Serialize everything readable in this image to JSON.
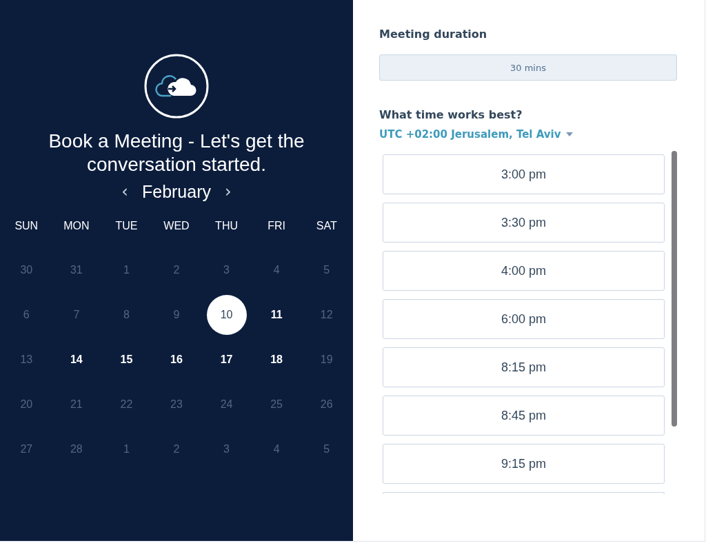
{
  "booking": {
    "title": "Book a Meeting - Let's get the conversation started.",
    "month": "February",
    "prev": "‹",
    "next": "›",
    "weekdays": [
      "SUN",
      "MON",
      "TUE",
      "WED",
      "THU",
      "FRI",
      "SAT"
    ],
    "weeks": [
      [
        {
          "day": "30",
          "available": false,
          "selected": false
        },
        {
          "day": "31",
          "available": false,
          "selected": false
        },
        {
          "day": "1",
          "available": false,
          "selected": false
        },
        {
          "day": "2",
          "available": false,
          "selected": false
        },
        {
          "day": "3",
          "available": false,
          "selected": false
        },
        {
          "day": "4",
          "available": false,
          "selected": false
        },
        {
          "day": "5",
          "available": false,
          "selected": false
        }
      ],
      [
        {
          "day": "6",
          "available": false,
          "selected": false
        },
        {
          "day": "7",
          "available": false,
          "selected": false
        },
        {
          "day": "8",
          "available": false,
          "selected": false
        },
        {
          "day": "9",
          "available": false,
          "selected": false
        },
        {
          "day": "10",
          "available": true,
          "selected": true
        },
        {
          "day": "11",
          "available": true,
          "selected": false
        },
        {
          "day": "12",
          "available": false,
          "selected": false
        }
      ],
      [
        {
          "day": "13",
          "available": false,
          "selected": false
        },
        {
          "day": "14",
          "available": true,
          "selected": false
        },
        {
          "day": "15",
          "available": true,
          "selected": false
        },
        {
          "day": "16",
          "available": true,
          "selected": false
        },
        {
          "day": "17",
          "available": true,
          "selected": false
        },
        {
          "day": "18",
          "available": true,
          "selected": false
        },
        {
          "day": "19",
          "available": false,
          "selected": false
        }
      ],
      [
        {
          "day": "20",
          "available": false,
          "selected": false
        },
        {
          "day": "21",
          "available": false,
          "selected": false
        },
        {
          "day": "22",
          "available": false,
          "selected": false
        },
        {
          "day": "23",
          "available": false,
          "selected": false
        },
        {
          "day": "24",
          "available": false,
          "selected": false
        },
        {
          "day": "25",
          "available": false,
          "selected": false
        },
        {
          "day": "26",
          "available": false,
          "selected": false
        }
      ],
      [
        {
          "day": "27",
          "available": false,
          "selected": false
        },
        {
          "day": "28",
          "available": false,
          "selected": false
        },
        {
          "day": "1",
          "available": false,
          "selected": false
        },
        {
          "day": "2",
          "available": false,
          "selected": false
        },
        {
          "day": "3",
          "available": false,
          "selected": false
        },
        {
          "day": "4",
          "available": false,
          "selected": false
        },
        {
          "day": "5",
          "available": false,
          "selected": false
        }
      ]
    ]
  },
  "duration": {
    "label": "Meeting duration",
    "value": "30 mins"
  },
  "times": {
    "label": "What time works best?",
    "timezone": "UTC +02:00 Jerusalem, Tel Aviv",
    "slots": [
      "3:00 pm",
      "3:30 pm",
      "4:00 pm",
      "6:00 pm",
      "8:15 pm",
      "8:45 pm",
      "9:15 pm"
    ]
  }
}
